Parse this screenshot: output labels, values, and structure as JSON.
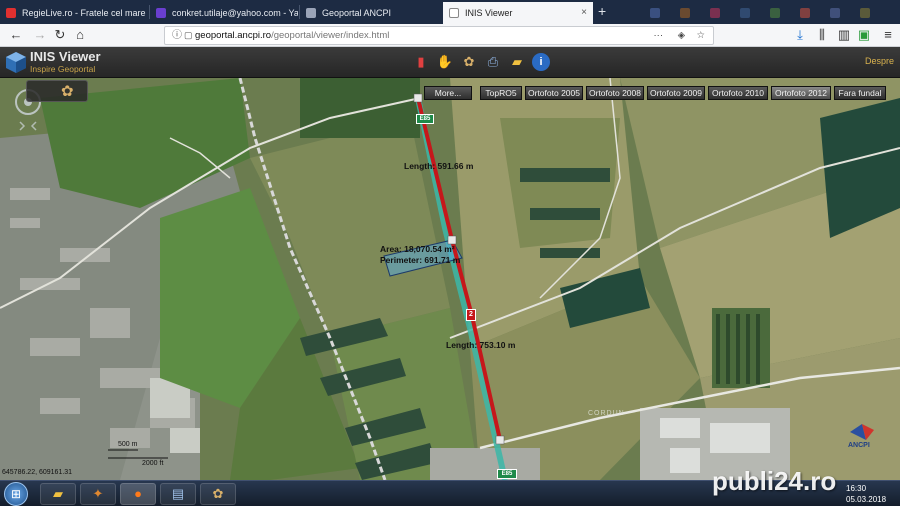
{
  "browser": {
    "tabs": [
      {
        "label": "RegieLive.ro - Fratele cel mare",
        "icon_color": "#e03030"
      },
      {
        "label": "conkret.utilaje@yahoo.com - Yah",
        "icon_color": "#6a3fd0"
      },
      {
        "label": "Geoportal ANCPI",
        "icon_color": "#9aa4b8"
      },
      {
        "label": "INIS Viewer",
        "icon_color": "#ffffff",
        "active": true
      }
    ],
    "new_tab": "+",
    "close": "×",
    "url_host": "geoportal.ancpi.ro",
    "url_path": "/geoportal/viewer/index.html",
    "url_menu": "···"
  },
  "app": {
    "title": "INIS Viewer",
    "subtitle": "Inspire Geoportal",
    "logout": "Despre"
  },
  "layers": [
    {
      "label": "More..."
    },
    {
      "label": "TopRO5"
    },
    {
      "label": "Ortofoto 2005"
    },
    {
      "label": "Ortofoto 2008"
    },
    {
      "label": "Ortofoto 2009"
    },
    {
      "label": "Ortofoto 2010"
    },
    {
      "label": "Ortofoto 2012",
      "active": true
    },
    {
      "label": "Fara fundal"
    }
  ],
  "measure": {
    "length_top": "Length: 591.66 m",
    "area": "Area: 18,070.54 m²",
    "perimeter": "Perimeter: 691.71 m",
    "length_bottom": "Length: 753.10 m",
    "vertex_label": "2",
    "road_sign_top": "E85",
    "road_sign_bottom": "E85"
  },
  "map_text": {
    "scale_m": "500 m",
    "scale_ft": "2000 ft",
    "coords": "645786.22, 609161.31",
    "logo": "ANCPI",
    "place": "CORDUN"
  },
  "taskbar": {
    "time": "16:30",
    "date": "05.03.2018"
  },
  "watermark": "publi24.ro"
}
